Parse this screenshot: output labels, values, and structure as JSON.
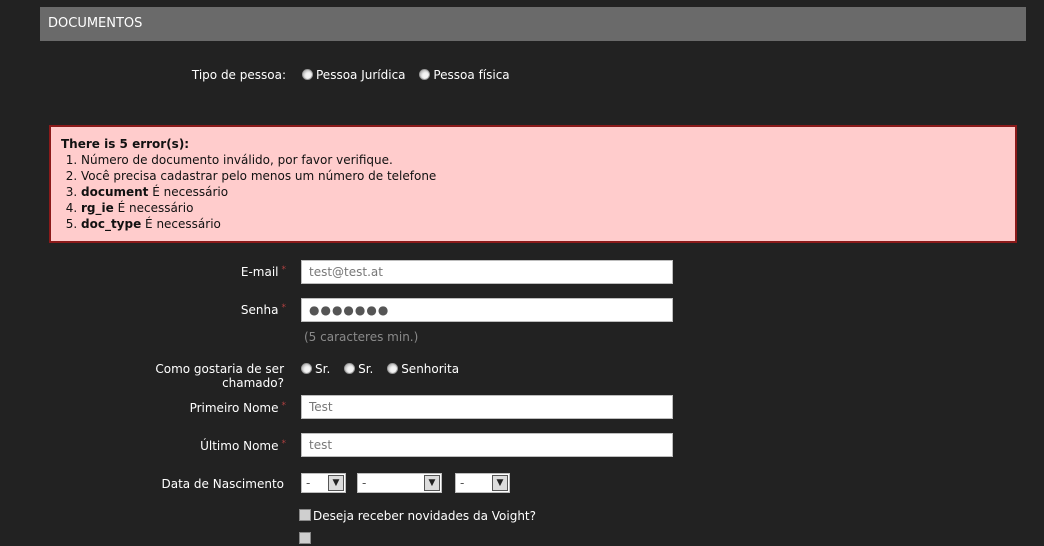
{
  "section": {
    "title": "DOCUMENTOS"
  },
  "person_type": {
    "label": "Tipo de pessoa:",
    "options": [
      "Pessoa Jurídica",
      "Pessoa física"
    ]
  },
  "errors": {
    "title": "There is 5 error(s):",
    "items": [
      {
        "strong": "",
        "text": "Número de documento inválido, por favor verifique."
      },
      {
        "strong": "",
        "text": "Você precisa cadastrar pelo menos um número de telefone"
      },
      {
        "strong": "document",
        "text": " É necessário"
      },
      {
        "strong": "rg_ie",
        "text": " É necessário"
      },
      {
        "strong": "doc_type",
        "text": " É necessário"
      }
    ]
  },
  "form": {
    "email": {
      "label": "E-mail",
      "required_mark": "*",
      "value": "test@test.at"
    },
    "password": {
      "label": "Senha",
      "required_mark": "*",
      "value": "●●●●●●●",
      "hint": "(5 caracteres min.)"
    },
    "title": {
      "label": "Como gostaria de ser chamado?",
      "options": [
        "Sr.",
        "Sr.",
        "Senhorita"
      ]
    },
    "first_name": {
      "label": "Primeiro Nome",
      "required_mark": "*",
      "value": "Test"
    },
    "last_name": {
      "label": "Último Nome",
      "required_mark": "*",
      "value": "test"
    },
    "birth_date": {
      "label": "Data de Nascimento",
      "day": "-",
      "month": "-",
      "year": "-",
      "arrow": "▼"
    },
    "newsletter": {
      "label": "Deseja receber novidades da Voight?"
    }
  }
}
